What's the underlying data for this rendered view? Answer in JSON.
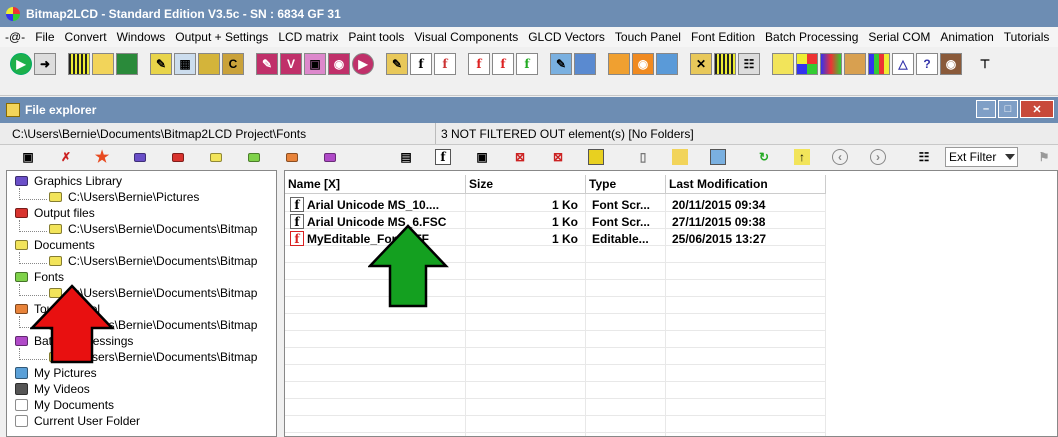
{
  "app": {
    "title": "Bitmap2LCD - Standard Edition V3.5c - SN : 6834 GF 31"
  },
  "menu": [
    "-@-",
    "File",
    "Convert",
    "Windows",
    "Output + Settings",
    "LCD matrix",
    "Paint tools",
    "Visual Components",
    "GLCD Vectors",
    "Touch Panel",
    "Font Edition",
    "Batch Processing",
    "Serial COM",
    "Animation",
    "Tutorials"
  ],
  "panel": {
    "title": "File explorer",
    "path": "C:\\Users\\Bernie\\Documents\\Bitmap2LCD Project\\Fonts",
    "count": "3 NOT FILTERED OUT element(s) [No Folders]",
    "ext_filter": "Ext Filter"
  },
  "tree": {
    "items": [
      {
        "label": "Graphics Library",
        "color": "#6a4fc8"
      },
      {
        "label": "C:\\Users\\Bernie\\Pictures",
        "color": "#f2e45a"
      },
      {
        "label": "Output files",
        "color": "#d8332e"
      },
      {
        "label": "C:\\Users\\Bernie\\Documents\\Bitmap",
        "color": "#f2e45a"
      },
      {
        "label": "Documents",
        "color": "#f2e45a"
      },
      {
        "label": "C:\\Users\\Bernie\\Documents\\Bitmap",
        "color": "#f2e45a"
      },
      {
        "label": "Fonts",
        "color": "#7fd24a"
      },
      {
        "label": "C:\\Users\\Bernie\\Documents\\Bitmap",
        "color": "#f2e45a"
      },
      {
        "label": "Touch Panel",
        "color": "#e8833a"
      },
      {
        "label": "C:\\Users\\Bernie\\Documents\\Bitmap",
        "color": "#f2e45a"
      },
      {
        "label": "Batch Processings",
        "color": "#b04ac8"
      },
      {
        "label": "C:\\Users\\Bernie\\Documents\\Bitmap",
        "color": "#f2e45a"
      },
      {
        "label": "My Pictures",
        "color": "#5aa0d8"
      },
      {
        "label": "My Videos",
        "color": "#555555"
      },
      {
        "label": "My Documents",
        "color": "#ffffff"
      },
      {
        "label": "Current User Folder",
        "color": "#ffffff"
      }
    ]
  },
  "list": {
    "columns": [
      "Name [X]",
      "Size",
      "Type",
      "Last Modification"
    ],
    "rows": [
      {
        "name": "Arial Unicode MS_10....",
        "size": "1 Ko",
        "type": "Font Scr...",
        "date": "20/11/2015 09:34",
        "icon_color": "#000000"
      },
      {
        "name": "Arial Unicode MS_6.FSC",
        "size": "1 Ko",
        "type": "Font Scr...",
        "date": "27/11/2015 09:38",
        "icon_color": "#000000"
      },
      {
        "name": "MyEditable_Font.EFF",
        "size": "1 Ko",
        "type": "Editable...",
        "date": "25/06/2015 13:27",
        "icon_color": "#d82020"
      }
    ]
  },
  "colors": {
    "titlebar": "#6d8db3",
    "red_arrow": "#e81010",
    "green_arrow": "#14a020"
  }
}
